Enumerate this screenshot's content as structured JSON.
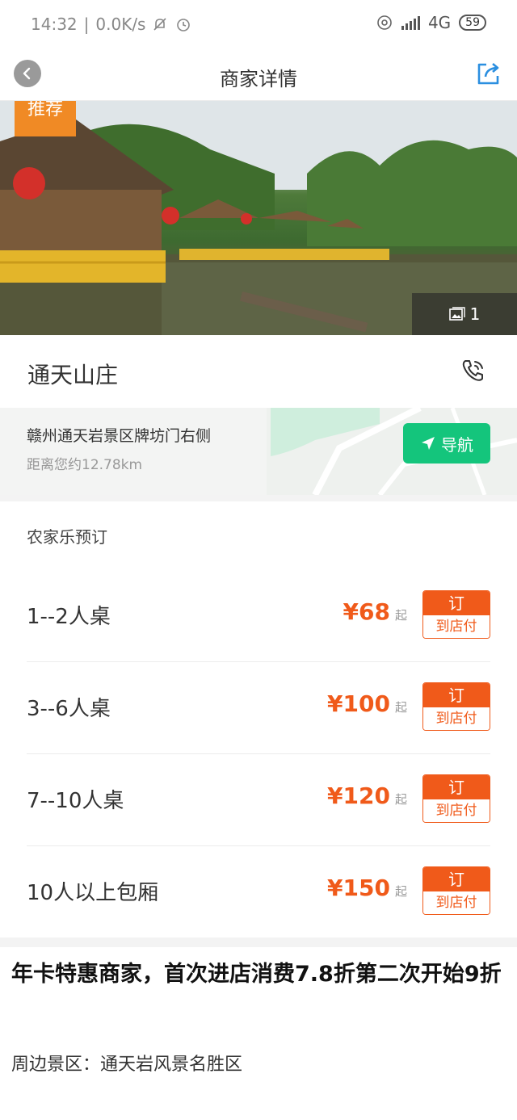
{
  "status_bar": {
    "time": "14:32",
    "separator": "|",
    "net_speed": "0.0K/s",
    "network": "4G",
    "battery": "59"
  },
  "header": {
    "title": "商家详情"
  },
  "hero": {
    "tag": "推荐",
    "photo_count": "1"
  },
  "shop": {
    "name": "通天山庄"
  },
  "address": {
    "text": "赣州通天岩景区牌坊门右侧",
    "distance": "距离您约12.78km",
    "nav_label": "导航"
  },
  "booking": {
    "title": "农家乐预订",
    "items": [
      {
        "name": "1--2人桌",
        "price": "¥68",
        "suffix": "起",
        "btn_top": "订",
        "btn_bottom": "到店付"
      },
      {
        "name": "3--6人桌",
        "price": "¥100",
        "suffix": "起",
        "btn_top": "订",
        "btn_bottom": "到店付"
      },
      {
        "name": "7--10人桌",
        "price": "¥120",
        "suffix": "起",
        "btn_top": "订",
        "btn_bottom": "到店付"
      },
      {
        "name": "10人以上包厢",
        "price": "¥150",
        "suffix": "起",
        "btn_top": "订",
        "btn_bottom": "到店付"
      }
    ]
  },
  "promo": "年卡特惠商家，首次进店消费7.8折第二次开始9折",
  "nearby": "周边景区：通天岩风景名胜区",
  "colors": {
    "accent": "#f05a1a",
    "nav_green": "#14c57c",
    "tag_orange": "#f08a25"
  }
}
